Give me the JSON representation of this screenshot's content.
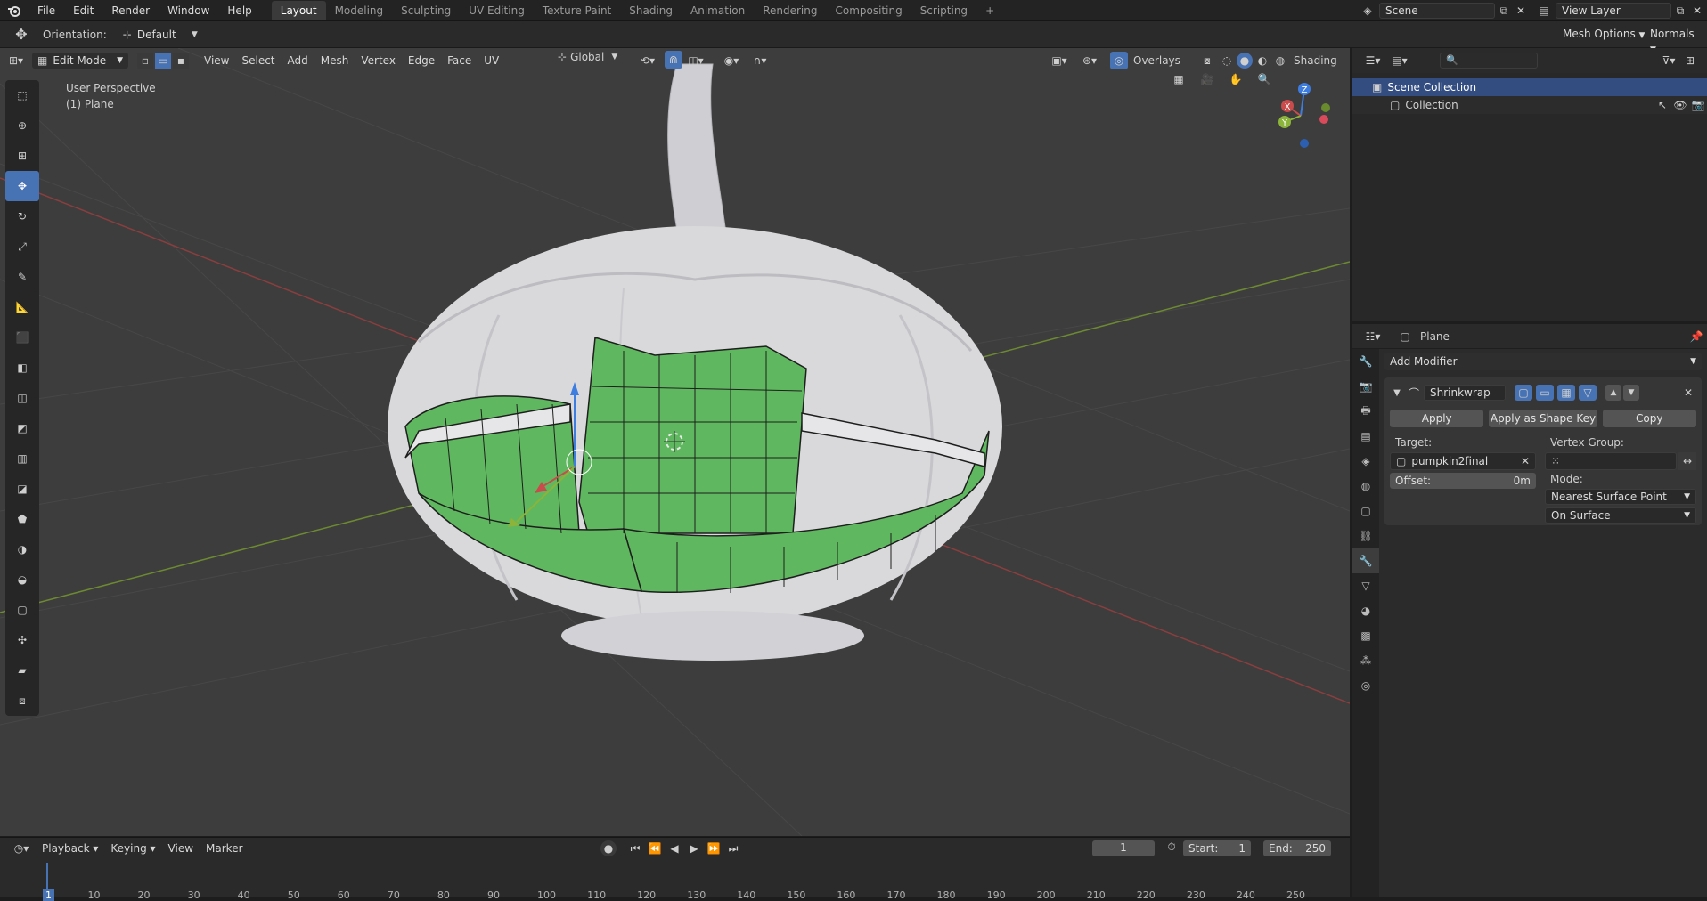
{
  "topbar": {
    "menus": [
      "File",
      "Edit",
      "Render",
      "Window",
      "Help"
    ],
    "workspaces": [
      "Layout",
      "Modeling",
      "Sculpting",
      "UV Editing",
      "Texture Paint",
      "Shading",
      "Animation",
      "Rendering",
      "Compositing",
      "Scripting"
    ],
    "active_workspace": "Layout",
    "add_tab": "+",
    "scene": "Scene",
    "view_layer": "View Layer"
  },
  "tool_header": {
    "orientation_label": "Orientation:",
    "orientation_value": "Default",
    "mesh_options": "Mesh Options",
    "normals": "Normals"
  },
  "viewport_header": {
    "mode": "Edit Mode",
    "menus": [
      "View",
      "Select",
      "Add",
      "Mesh",
      "Vertex",
      "Edge",
      "Face",
      "UV"
    ],
    "transform_orientation": "Global",
    "overlays": "Overlays",
    "shading": "Shading"
  },
  "viewport": {
    "perspective": "User Perspective",
    "object": "(1) Plane",
    "gizmo_axes": [
      "X",
      "Y",
      "Z"
    ]
  },
  "outliner": {
    "root": "Scene Collection",
    "items": [
      "Collection"
    ]
  },
  "properties": {
    "object_name": "Plane",
    "add_modifier": "Add Modifier",
    "modifier_name": "Shrinkwrap",
    "buttons": {
      "apply": "Apply",
      "apply_shape_key": "Apply as Shape Key",
      "copy": "Copy"
    },
    "target_label": "Target:",
    "target_value": "pumpkin2final",
    "vertex_group_label": "Vertex Group:",
    "offset_label": "Offset:",
    "offset_value": "0m",
    "mode_label": "Mode:",
    "mode_value": "Nearest Surface Point",
    "snap_mode_value": "On Surface"
  },
  "timeline": {
    "menus": [
      "Playback",
      "Keying",
      "View",
      "Marker"
    ],
    "current_frame": "1",
    "start_label": "Start:",
    "start": "1",
    "end_label": "End:",
    "end": "250",
    "ticks": [
      "1",
      "10",
      "20",
      "30",
      "40",
      "50",
      "60",
      "70",
      "80",
      "90",
      "100",
      "110",
      "120",
      "130",
      "140",
      "150",
      "160",
      "170",
      "180",
      "190",
      "200",
      "210",
      "220",
      "230",
      "240",
      "250"
    ]
  },
  "colors": {
    "accent": "#4772b3",
    "mesh_face": "#5fb85f",
    "pumpkin": "#d9d9dc",
    "x_axis": "#c94b4b",
    "y_axis": "#8cb33a",
    "z_axis": "#3e7de0"
  }
}
